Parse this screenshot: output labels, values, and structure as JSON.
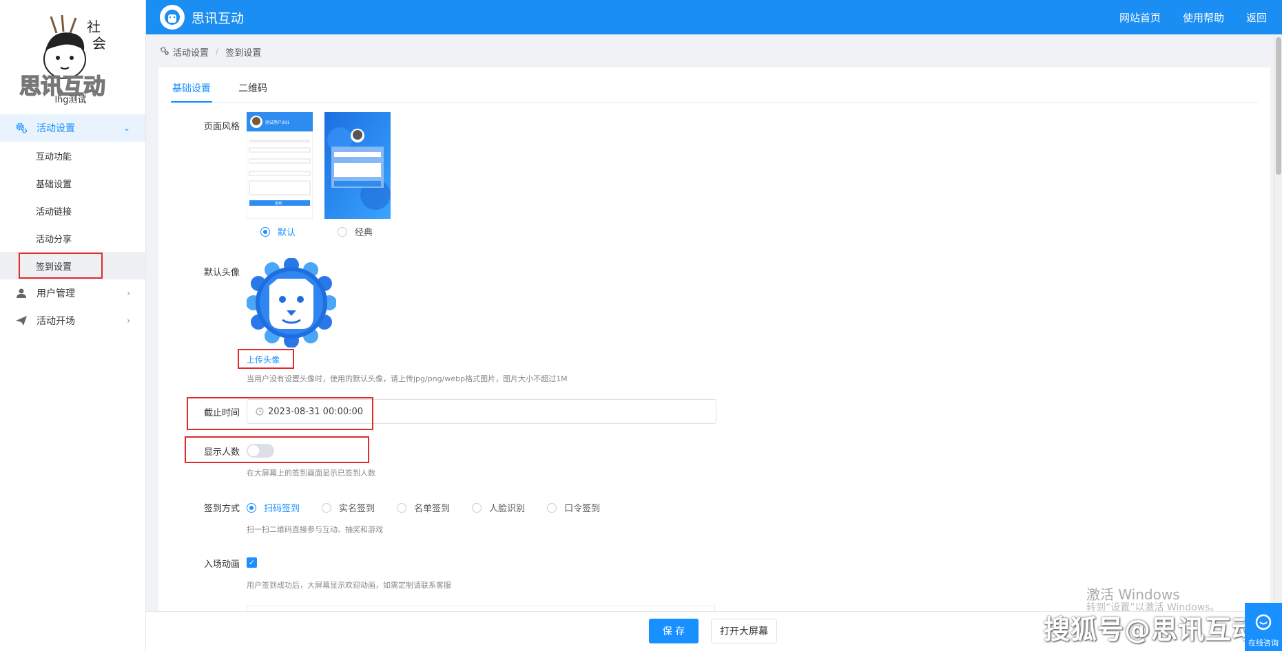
{
  "sidebar": {
    "logo_text": "思讯互动",
    "user_name": "lhg测试",
    "menu": [
      {
        "label": "活动设置",
        "icon": "gear-icon",
        "active": true,
        "children": [
          "互动功能",
          "基础设置",
          "活动链接",
          "活动分享",
          "签到设置"
        ]
      },
      {
        "label": "用户管理",
        "icon": "user-icon"
      },
      {
        "label": "活动开场",
        "icon": "paper-plane-icon"
      }
    ]
  },
  "topbar": {
    "brand": "思讯互动",
    "links": [
      "网站首页",
      "使用帮助",
      "返回"
    ]
  },
  "breadcrumb": {
    "parent": "活动设置",
    "current": "签到设置"
  },
  "tabs": [
    "基础设置",
    "二维码"
  ],
  "form": {
    "page_style": {
      "label": "页面风格",
      "options": [
        "默认",
        "经典"
      ],
      "selected": "默认",
      "preview_user": "测试用户291",
      "preview_submit": "签到"
    },
    "avatar": {
      "label": "默认头像",
      "upload_link": "上传头像",
      "hint": "当用户没有设置头像时，使用的默认头像，请上传jpg/png/webp格式图片，图片大小不超过1M"
    },
    "deadline": {
      "label": "截止时间",
      "value": "2023-08-31 00:00:00"
    },
    "show_count": {
      "label": "显示人数",
      "enabled": false,
      "hint": "在大屏幕上的签到画面显示已签到人数"
    },
    "sign_method": {
      "label": "签到方式",
      "options": [
        "扫码签到",
        "实名签到",
        "名单签到",
        "人脸识别",
        "口令签到"
      ],
      "selected": "扫码签到",
      "hint": "扫一扫二维码直接参与互动、抽奖和游戏"
    },
    "entry_anim": {
      "label": "入场动画",
      "checked": true,
      "hint": "用户签到成功后，大屏幕显示欢迎动画，如需定制请联系客服"
    }
  },
  "footer": {
    "save": "保 存",
    "open_screen": "打开大屏幕"
  },
  "overlay": {
    "windows_title": "激活 Windows",
    "windows_sub": "转到“设置”以激活 Windows。",
    "sohu": "搜狐号@思讯互动",
    "chat": "在线咨询"
  },
  "colors": {
    "primary": "#1890ff",
    "topbar": "#1a8ef2",
    "highlight": "#e02b2b"
  }
}
